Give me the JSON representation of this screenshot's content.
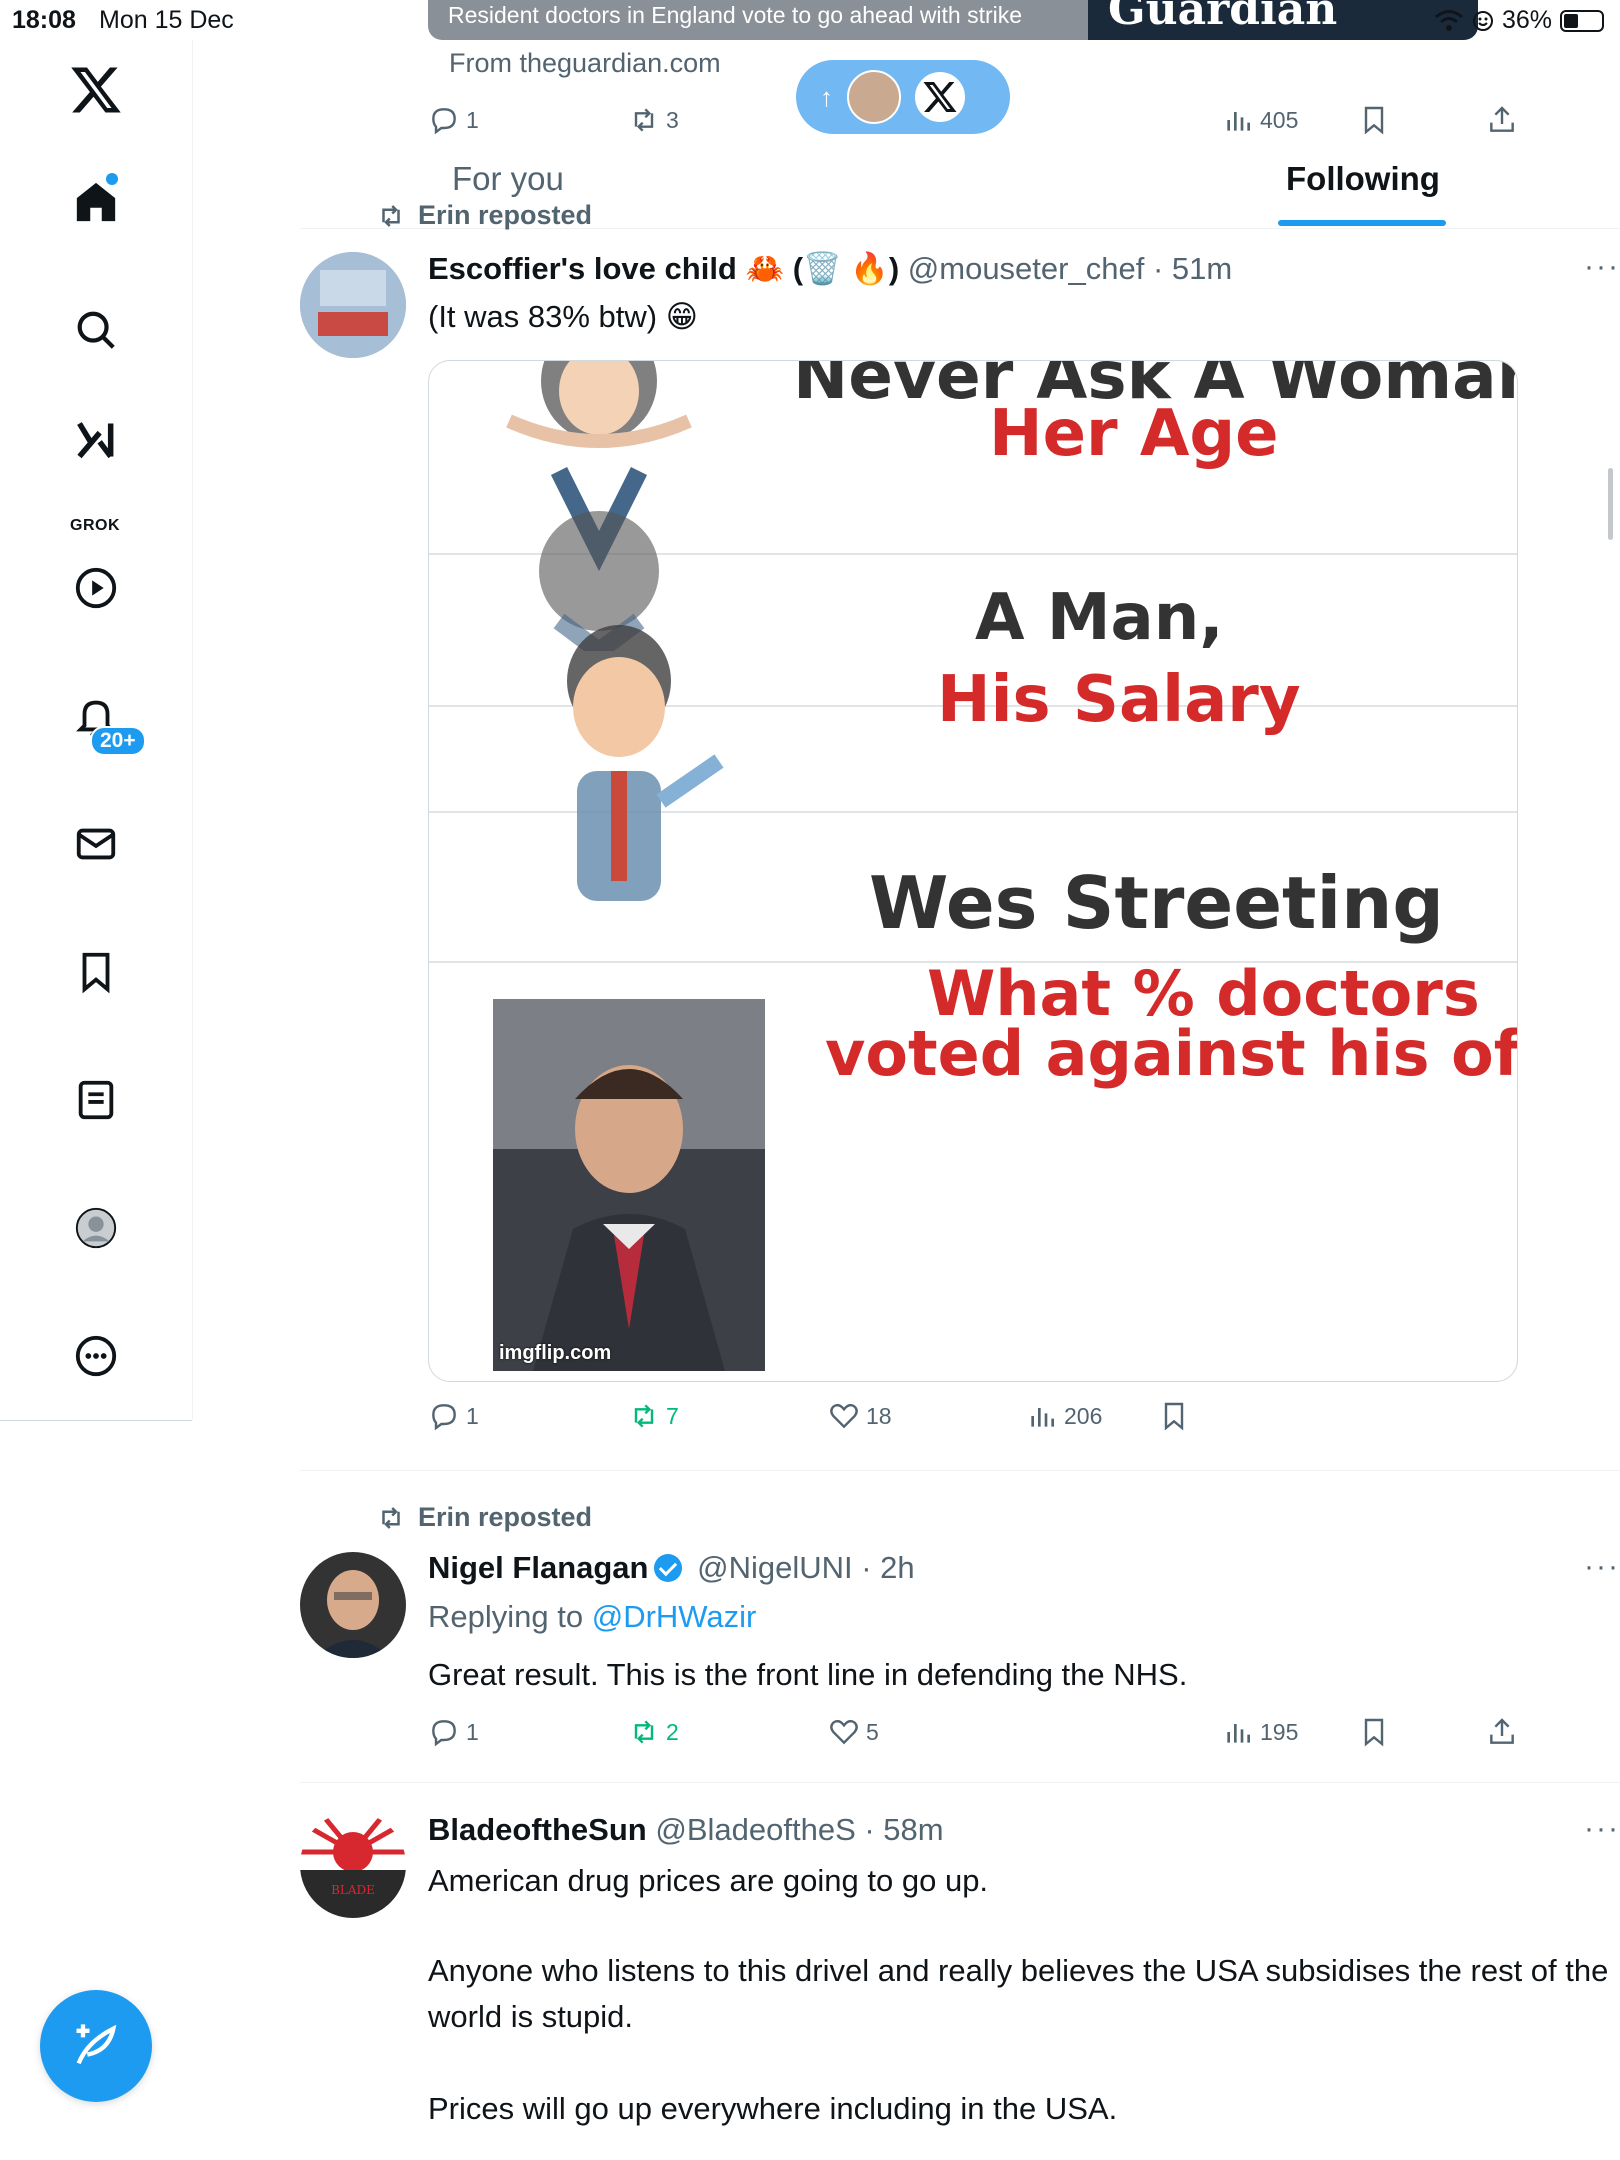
{
  "status_bar": {
    "time": "18:08",
    "date": "Mon 15 Dec",
    "battery": "36%"
  },
  "sidebar": {
    "items": [
      {
        "icon": "x-logo-icon"
      },
      {
        "icon": "home-icon"
      },
      {
        "icon": "search-icon"
      },
      {
        "icon": "grok-icon",
        "label": "GROK"
      },
      {
        "icon": "video-icon"
      },
      {
        "icon": "bell-icon",
        "badge": "20+"
      },
      {
        "icon": "mail-icon"
      },
      {
        "icon": "bookmark-icon"
      },
      {
        "icon": "lists-icon"
      },
      {
        "icon": "profile-icon"
      },
      {
        "icon": "more-icon"
      }
    ]
  },
  "top_card": {
    "caption": "Resident doctors in England vote to go ahead with strike",
    "logo_text": "Guardian",
    "from": "From theguardian.com",
    "stats": {
      "replies": "1",
      "reposts": "3",
      "views": "405"
    }
  },
  "tabs": [
    {
      "label": "For you"
    },
    {
      "label": "Following"
    }
  ],
  "posts": [
    {
      "reposted_by": "Erin reposted",
      "name": "Escoffier's love child 🦀 (🗑️ 🔥)",
      "handle": "@mouseter_chef",
      "time": "· 51m",
      "text": "(It was 83% btw) 😁",
      "meme": {
        "lines": [
          {
            "text": "Never Ask A Woman",
            "color": "black"
          },
          {
            "text": "Her Age",
            "color": "red"
          },
          {
            "text": "A Man,",
            "color": "black"
          },
          {
            "text": "His Salary",
            "color": "red"
          },
          {
            "text": "Wes Streeting",
            "color": "black"
          },
          {
            "text": "What % doctors",
            "color": "red"
          },
          {
            "text": "voted against his offer",
            "color": "red"
          }
        ],
        "watermark": "imgflip.com"
      },
      "stats": {
        "replies": "1",
        "reposts": "7",
        "likes": "18",
        "views": "206"
      }
    },
    {
      "reposted_by": "Erin reposted",
      "name": "Nigel Flanagan",
      "handle": "@NigelUNI",
      "time": "· 2h",
      "reply_prefix": "Replying to ",
      "reply_to": "@DrHWazir",
      "text": "Great result. This is the front line in defending the NHS.",
      "stats": {
        "replies": "1",
        "reposts": "2",
        "likes": "5",
        "views": "195"
      }
    },
    {
      "name": "BladeoftheSun",
      "handle": "@BladeoftheS",
      "time": "· 58m",
      "text": "American drug prices are going to go up."
    },
    {
      "text": "Anyone who listens to this drivel and really believes the USA subsidises the rest of the world is stupid."
    },
    {
      "text": "Prices will go up everywhere including in the USA."
    }
  ]
}
